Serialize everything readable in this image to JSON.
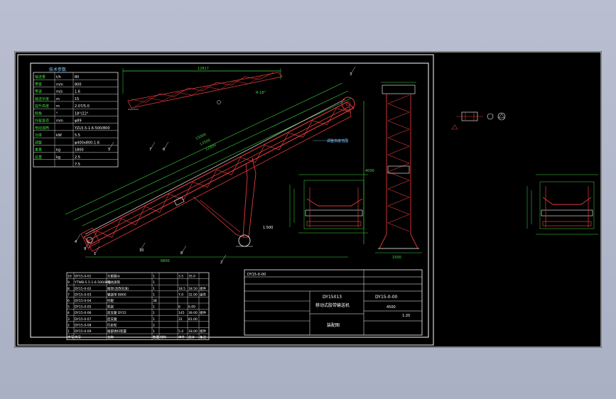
{
  "viewport": {
    "background": "#000000"
  },
  "colors": {
    "frame": "#ffffff",
    "conveyor": "#e33a3a",
    "dimension": "#3fdc3f",
    "table": "#ffffff",
    "annotation": "#7ec8ff",
    "steel": "#ff4040"
  },
  "param_table": {
    "header": "技术参数",
    "rows": [
      [
        "输送量",
        "t/h",
        "80"
      ],
      [
        "带宽",
        "mm",
        "800"
      ],
      [
        "带速",
        "m/s",
        "1.6"
      ],
      [
        "输送长度",
        "m",
        "15"
      ],
      [
        "提升高度",
        "m",
        "2.07/5.0"
      ],
      [
        "倾角",
        "°",
        "18°/22°"
      ],
      [
        "托辊直径",
        "mm",
        "φ89"
      ],
      [
        "电动滚筒",
        "",
        "YZL5.5-1.6-500/800"
      ],
      [
        "功率",
        "kW",
        "5.5"
      ],
      [
        "调整",
        "",
        "φ400x800-1.6"
      ],
      [
        "重量",
        "kg",
        "1800"
      ],
      [
        "总重",
        "kg",
        "2.5"
      ],
      [
        "",
        "",
        "7.5"
      ]
    ]
  },
  "bom": {
    "rows": [
      [
        "10",
        "DY15-0-01",
        "头部漏斗",
        "1",
        "",
        "3.5",
        "35.0",
        ""
      ],
      [
        "9",
        "YTWB-5.5-1.6-500/800",
        "电动滚筒",
        "1",
        "",
        "",
        "",
        ""
      ],
      [
        "8",
        "DY15-0-02",
        "尾架(含改向滚)",
        "1",
        "",
        "18.5",
        "18.50",
        "组件"
      ],
      [
        "7",
        "DY15-0-03",
        "输送带 B800",
        "1",
        "",
        "7.0",
        "32.00",
        "组件"
      ],
      [
        "6",
        "DY15-0-04",
        "托辊",
        "38",
        "",
        "",
        "",
        ""
      ],
      [
        "5",
        "DY15-0-05",
        "机架",
        "1",
        "",
        "6",
        "6.00",
        ""
      ],
      [
        "4",
        "DY15-0-06",
        "前支腿 DY15",
        "1",
        "",
        "145",
        "39.00",
        "组件"
      ],
      [
        "3",
        "DY15-0-07",
        "后支腿",
        "1",
        "",
        "31",
        "81.00",
        ""
      ],
      [
        "2",
        "DY15-0-08",
        "行走轮",
        "2",
        "",
        "",
        "",
        ""
      ],
      [
        "1",
        "DY15-0-09",
        "尾部清扫装置",
        "1",
        "",
        "5.4",
        "18.00",
        "组件"
      ]
    ],
    "footer": [
      "序号",
      "代号",
      "名称",
      "数量",
      "材料",
      "单件",
      "总计",
      "备注"
    ]
  },
  "title_block": {
    "drawing_no": "DY15-0-00",
    "scale": "1:20",
    "product": "DY15013",
    "name": "移动式胶带输送机",
    "assembly": "装配图",
    "weight": "4500"
  },
  "labels": {
    "balloons": [
      "1",
      "2",
      "3",
      "4",
      "5",
      "6",
      "7",
      "8",
      "9",
      "10"
    ],
    "dim_top": "12817",
    "dim_long_1": "15000",
    "dim_long_2": "13500",
    "dim_long_3": "12800",
    "dim_height": "4000",
    "dim_base": "6800",
    "dim_width": "1500",
    "angle_1": "R-18°",
    "angle_2": "R-22°",
    "note_1": "调整高度范围",
    "note_2": "1.500"
  }
}
